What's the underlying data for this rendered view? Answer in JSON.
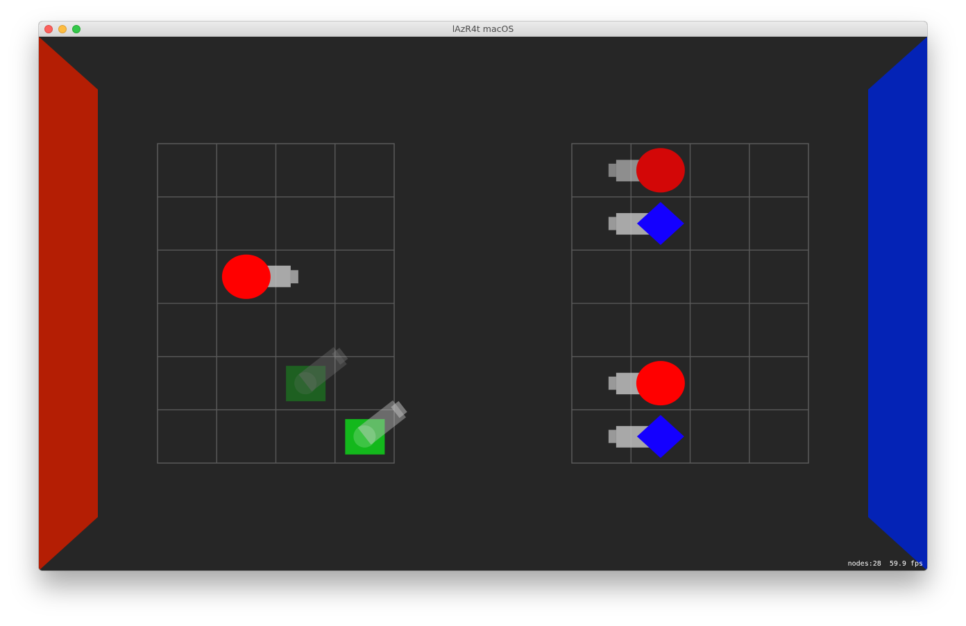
{
  "window": {
    "title": "lAzR4t macOS"
  },
  "colors": {
    "background": "#262626",
    "left_wall": "#b41e04",
    "right_wall": "#0423b6",
    "grid_line": "#5a5a5a",
    "red_unit": "#ff0000",
    "blue_unit": "#1400ff",
    "green_unit": "#13b81c",
    "cannon": "#c0c0c0"
  },
  "scene": {
    "left_board": {
      "columns": 4,
      "rows": 6
    },
    "right_board": {
      "columns": 4,
      "rows": 6
    },
    "units": [
      {
        "name": "red-circle-unit",
        "shape": "circle",
        "color": "red",
        "board": "left",
        "col": 1,
        "row": 2,
        "facing": "right",
        "opacity": 1
      },
      {
        "name": "green-square-unit-ghost",
        "shape": "square",
        "color": "green",
        "board": "left",
        "col": 2,
        "row": 4,
        "facing": "up-right",
        "opacity": 0.4
      },
      {
        "name": "green-square-unit",
        "shape": "square",
        "color": "green",
        "board": "left",
        "col": 3,
        "row": 5,
        "facing": "up-right",
        "opacity": 1
      },
      {
        "name": "red-circle-unit-faded",
        "shape": "circle",
        "color": "red",
        "board": "right",
        "col": 1,
        "row": 0,
        "facing": "left",
        "opacity": 0.8
      },
      {
        "name": "blue-diamond-unit",
        "shape": "diamond",
        "color": "blue",
        "board": "right",
        "col": 1,
        "row": 1,
        "facing": "left",
        "opacity": 1
      },
      {
        "name": "red-circle-unit-right",
        "shape": "circle",
        "color": "red",
        "board": "right",
        "col": 1,
        "row": 4,
        "facing": "left",
        "opacity": 1
      },
      {
        "name": "blue-diamond-unit-lower",
        "shape": "diamond",
        "color": "blue",
        "board": "right",
        "col": 1,
        "row": 5,
        "facing": "left",
        "opacity": 1
      }
    ]
  },
  "stats": {
    "nodes_label": "nodes:28",
    "fps_label": "59.9 fps"
  }
}
